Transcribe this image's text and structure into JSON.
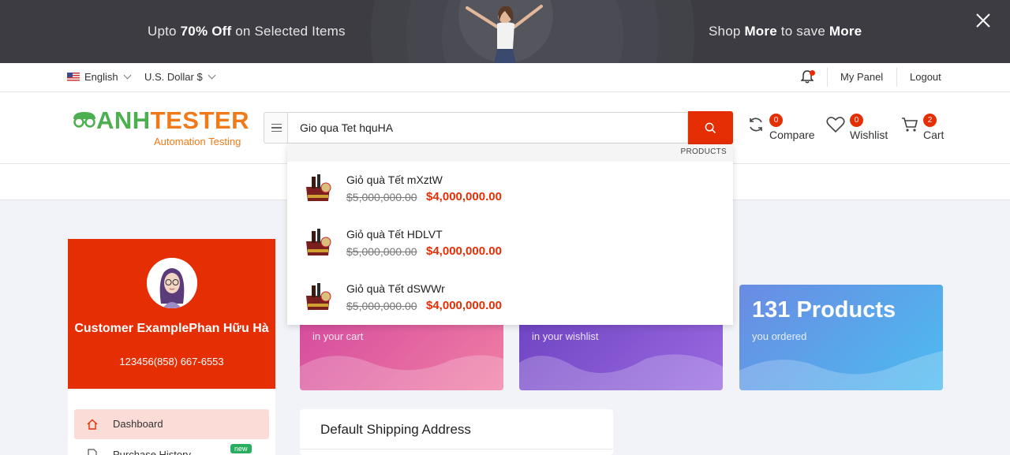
{
  "promo": {
    "left_pre": "Upto ",
    "left_bold": "70% Off",
    "left_post": " on Selected Items",
    "right_pre": "Shop ",
    "right_bold1": "More",
    "right_mid": " to save ",
    "right_bold2": "More"
  },
  "topbar": {
    "language": "English",
    "currency": "U.S. Dollar $",
    "my_panel": "My Panel",
    "logout": "Logout"
  },
  "logo": {
    "brand_green": "ANH",
    "brand_orange": "TESTER",
    "subtitle": "Automation Testing"
  },
  "search": {
    "value": "Gio qua Tet hquHA",
    "category_label": "PRODUCTS"
  },
  "header_icons": {
    "compare": {
      "label": "Compare",
      "count": "0"
    },
    "wishlist": {
      "label": "Wishlist",
      "count": "0"
    },
    "cart": {
      "label": "Cart",
      "count": "2"
    }
  },
  "suggestions": [
    {
      "name": "Giỏ quà Tết mXztW",
      "old_price": "$5,000,000.00",
      "price": "$4,000,000.00"
    },
    {
      "name": "Giỏ quà Tết HDLVT",
      "old_price": "$5,000,000.00",
      "price": "$4,000,000.00"
    },
    {
      "name": "Giỏ quà Tết dSWWr",
      "old_price": "$5,000,000.00",
      "price": "$4,000,000.00"
    }
  ],
  "profile": {
    "name": "Customer ExamplePhan Hữu Hà",
    "phone": "123456(858) 667-6553"
  },
  "sidebar": {
    "items": [
      {
        "label": "Dashboard",
        "icon": "home-icon"
      },
      {
        "label": "Purchase History",
        "icon": "file-icon",
        "badge": "new"
      }
    ]
  },
  "cards": [
    {
      "big": "",
      "small": "in your cart",
      "color": "#e05aa0"
    },
    {
      "big": "",
      "small": "in your wishlist",
      "color": "#7f55d0"
    },
    {
      "big": "131 Products",
      "small": "you ordered",
      "color": "#5aa6ec"
    }
  ],
  "shipping": {
    "title": "Default Shipping Address"
  },
  "colors": {
    "primary": "#e62e04",
    "dark_banner": "#3c3c42"
  }
}
